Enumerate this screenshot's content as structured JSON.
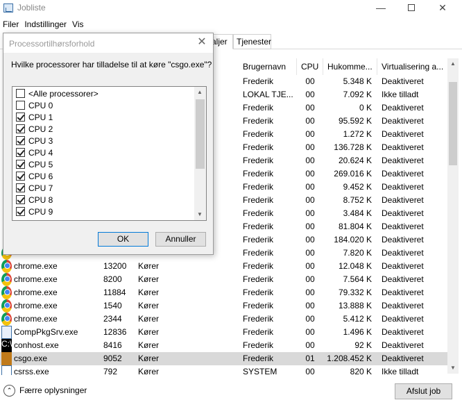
{
  "window": {
    "title": "Jobliste"
  },
  "menu": [
    "Filer",
    "Indstillinger",
    "Vis"
  ],
  "tabs": [
    "aljer",
    "Tjenester"
  ],
  "columns": {
    "user": "Brugernavn",
    "cpu": "CPU",
    "memory": "Hukomme...",
    "virtualization": "Virtualisering a..."
  },
  "rows": [
    {
      "name": "",
      "pid": "",
      "status": "",
      "user": "Frederik",
      "cpu": "00",
      "mem": "5.348 K",
      "virt": "Deaktiveret",
      "icon": ""
    },
    {
      "name": "",
      "pid": "",
      "status": "",
      "user": "LOKAL TJE...",
      "cpu": "00",
      "mem": "7.092 K",
      "virt": "Ikke tilladt",
      "icon": ""
    },
    {
      "name": "",
      "pid": "",
      "status": "",
      "user": "Frederik",
      "cpu": "00",
      "mem": "0 K",
      "virt": "Deaktiveret",
      "icon": ""
    },
    {
      "name": "",
      "pid": "",
      "status": "",
      "user": "Frederik",
      "cpu": "00",
      "mem": "95.592 K",
      "virt": "Deaktiveret",
      "icon": ""
    },
    {
      "name": "",
      "pid": "",
      "status": "",
      "user": "Frederik",
      "cpu": "00",
      "mem": "1.272 K",
      "virt": "Deaktiveret",
      "icon": ""
    },
    {
      "name": "",
      "pid": "",
      "status": "",
      "user": "Frederik",
      "cpu": "00",
      "mem": "136.728 K",
      "virt": "Deaktiveret",
      "icon": ""
    },
    {
      "name": "",
      "pid": "",
      "status": "",
      "user": "Frederik",
      "cpu": "00",
      "mem": "20.624 K",
      "virt": "Deaktiveret",
      "icon": ""
    },
    {
      "name": "",
      "pid": "",
      "status": "",
      "user": "Frederik",
      "cpu": "00",
      "mem": "269.016 K",
      "virt": "Deaktiveret",
      "icon": ""
    },
    {
      "name": "",
      "pid": "",
      "status": "",
      "user": "Frederik",
      "cpu": "00",
      "mem": "9.452 K",
      "virt": "Deaktiveret",
      "icon": ""
    },
    {
      "name": "",
      "pid": "",
      "status": "",
      "user": "Frederik",
      "cpu": "00",
      "mem": "8.752 K",
      "virt": "Deaktiveret",
      "icon": ""
    },
    {
      "name": "",
      "pid": "",
      "status": "",
      "user": "Frederik",
      "cpu": "00",
      "mem": "3.484 K",
      "virt": "Deaktiveret",
      "icon": ""
    },
    {
      "name": "",
      "pid": "",
      "status": "",
      "user": "Frederik",
      "cpu": "00",
      "mem": "81.804 K",
      "virt": "Deaktiveret",
      "icon": ""
    },
    {
      "name": "",
      "pid": "",
      "status": "",
      "user": "Frederik",
      "cpu": "00",
      "mem": "184.020 K",
      "virt": "Deaktiveret",
      "icon": ""
    },
    {
      "name": "",
      "pid": "",
      "status": "",
      "user": "Frederik",
      "cpu": "00",
      "mem": "7.820 K",
      "virt": "Deaktiveret",
      "icon": "chrome"
    },
    {
      "name": "chrome.exe",
      "pid": "13200",
      "status": "Kører",
      "user": "Frederik",
      "cpu": "00",
      "mem": "12.048 K",
      "virt": "Deaktiveret",
      "icon": "chrome"
    },
    {
      "name": "chrome.exe",
      "pid": "8200",
      "status": "Kører",
      "user": "Frederik",
      "cpu": "00",
      "mem": "7.564 K",
      "virt": "Deaktiveret",
      "icon": "chrome"
    },
    {
      "name": "chrome.exe",
      "pid": "11884",
      "status": "Kører",
      "user": "Frederik",
      "cpu": "00",
      "mem": "79.332 K",
      "virt": "Deaktiveret",
      "icon": "chrome"
    },
    {
      "name": "chrome.exe",
      "pid": "1540",
      "status": "Kører",
      "user": "Frederik",
      "cpu": "00",
      "mem": "13.888 K",
      "virt": "Deaktiveret",
      "icon": "chrome"
    },
    {
      "name": "chrome.exe",
      "pid": "2344",
      "status": "Kører",
      "user": "Frederik",
      "cpu": "00",
      "mem": "5.412 K",
      "virt": "Deaktiveret",
      "icon": "chrome"
    },
    {
      "name": "CompPkgSrv.exe",
      "pid": "12836",
      "status": "Kører",
      "user": "Frederik",
      "cpu": "00",
      "mem": "1.496 K",
      "virt": "Deaktiveret",
      "icon": "pkg"
    },
    {
      "name": "conhost.exe",
      "pid": "8416",
      "status": "Kører",
      "user": "Frederik",
      "cpu": "00",
      "mem": "92 K",
      "virt": "Deaktiveret",
      "icon": "cmd"
    },
    {
      "name": "csgo.exe",
      "pid": "9052",
      "status": "Kører",
      "user": "Frederik",
      "cpu": "01",
      "mem": "1.208.452 K",
      "virt": "Deaktiveret",
      "icon": "csgo",
      "selected": true
    },
    {
      "name": "csrss.exe",
      "pid": "792",
      "status": "Kører",
      "user": "SYSTEM",
      "cpu": "00",
      "mem": "820 K",
      "virt": "Ikke tilladt",
      "icon": "sys"
    }
  ],
  "footer": {
    "fewer_details": "Færre oplysninger",
    "end_task": "Afslut job"
  },
  "dialog": {
    "title": "Processortilhørsforhold",
    "question": "Hvilke processorer har tilladelse til at køre \"csgo.exe\"?",
    "items": [
      {
        "label": "<Alle processorer>",
        "checked": false
      },
      {
        "label": "CPU 0",
        "checked": false
      },
      {
        "label": "CPU 1",
        "checked": true
      },
      {
        "label": "CPU 2",
        "checked": true
      },
      {
        "label": "CPU 3",
        "checked": true
      },
      {
        "label": "CPU 4",
        "checked": true
      },
      {
        "label": "CPU 5",
        "checked": true
      },
      {
        "label": "CPU 6",
        "checked": true
      },
      {
        "label": "CPU 7",
        "checked": true
      },
      {
        "label": "CPU 8",
        "checked": true
      },
      {
        "label": "CPU 9",
        "checked": true
      }
    ],
    "ok": "OK",
    "cancel": "Annuller"
  }
}
